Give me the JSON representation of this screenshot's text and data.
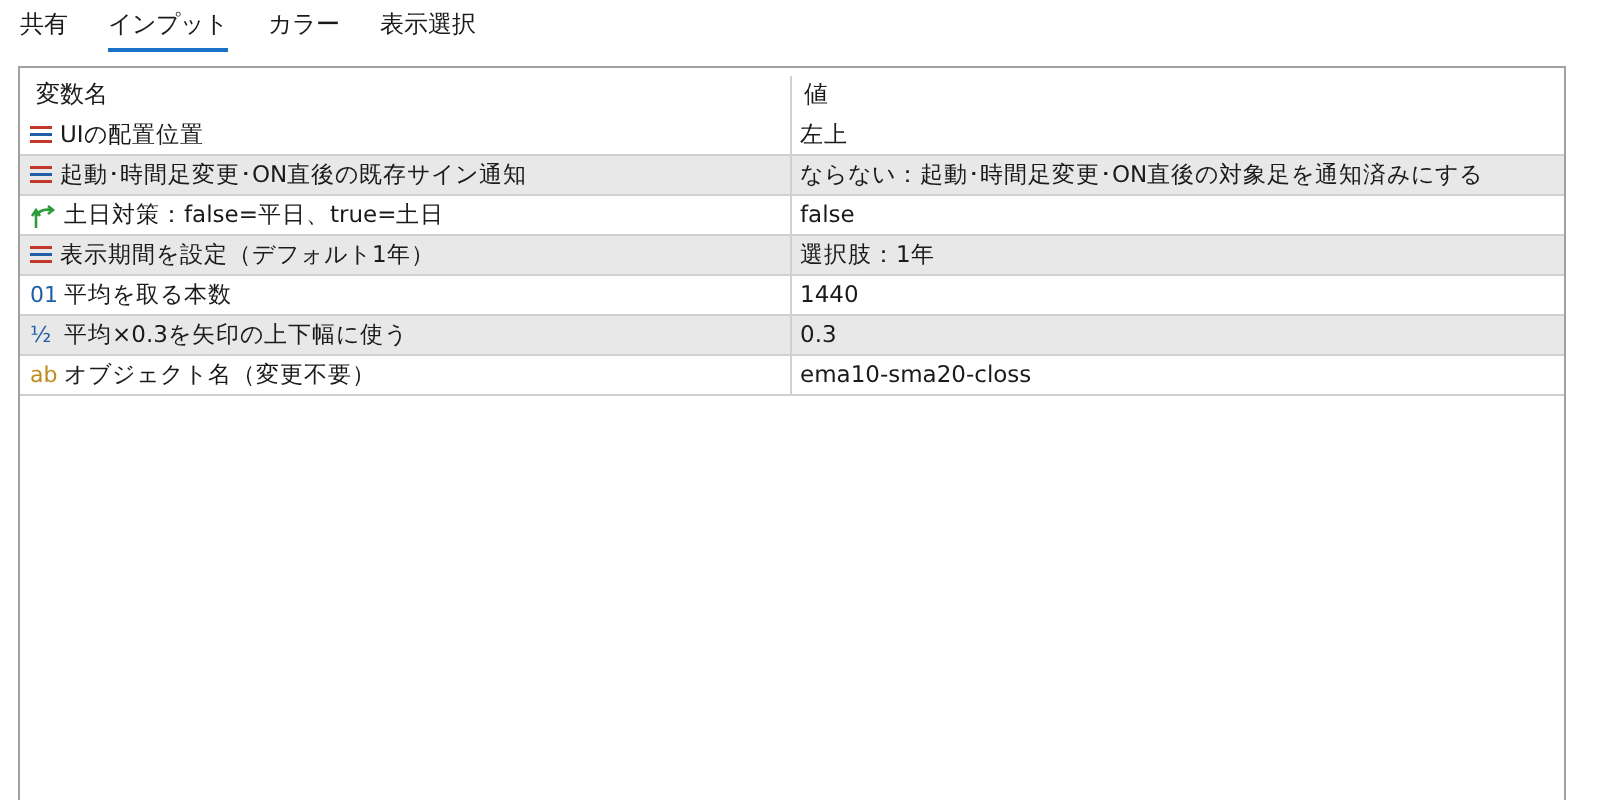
{
  "tabs": [
    {
      "label": "共有",
      "selected": false
    },
    {
      "label": "インプット",
      "selected": true
    },
    {
      "label": "カラー",
      "selected": false
    },
    {
      "label": "表示選択",
      "selected": false
    }
  ],
  "table": {
    "columns": [
      "変数名",
      "値"
    ],
    "rows": [
      {
        "kind": "enum",
        "name": "UIの配置位置",
        "value": "左上"
      },
      {
        "kind": "enum",
        "name": "起動･時間足変更･ON直後の既存サイン通知",
        "value": "ならない：起動･時間足変更･ON直後の対象足を通知済みにする"
      },
      {
        "kind": "bool",
        "name": "土日対策：false=平日、true=土日",
        "value": "false"
      },
      {
        "kind": "enum",
        "name": "表示期間を設定（デフォルト1年）",
        "value": "選択肢：1年"
      },
      {
        "kind": "int",
        "icon_text": "01",
        "name": "平均を取る本数",
        "value": "1440"
      },
      {
        "kind": "double",
        "icon_text": "½",
        "name": "平均×0.3を矢印の上下幅に使う",
        "value": "0.3"
      },
      {
        "kind": "string",
        "icon_text": "ab",
        "name": "オブジェクト名（変更不要）",
        "value": "ema10-sma20-closs"
      }
    ]
  }
}
